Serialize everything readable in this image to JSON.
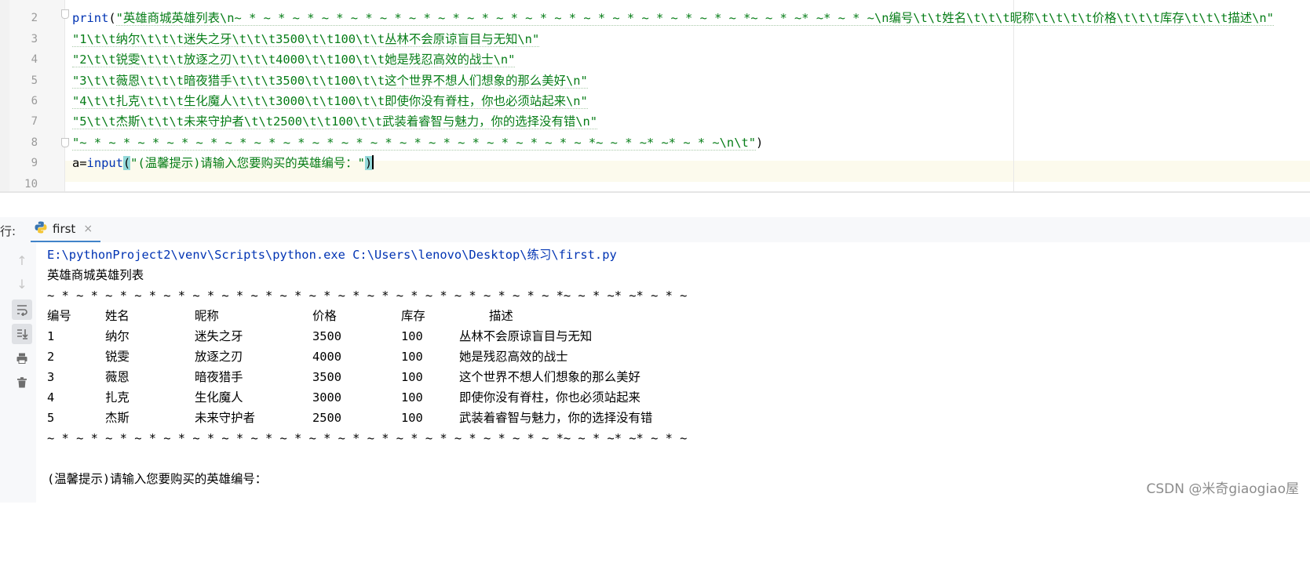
{
  "editor": {
    "line_numbers": [
      "2",
      "3",
      "4",
      "5",
      "6",
      "7",
      "8",
      "9",
      "10"
    ],
    "lines": {
      "l2_kw": "print",
      "l2_paren": "(",
      "l2_str": "\"英雄商城英雄列表\\n~ * ~ * ~ * ~ * ~ * ~ * ~ * ~ * ~ * ~ * ~ * ~ * ~ * ~ * ~ * ~ * ~ * ~ *~ ~ * ~* ~* ~ * ~\\n编号\\t\\t姓名\\t\\t\\t昵称\\t\\t\\t\\t价格\\t\\t\\t库存\\t\\t\\t描述\\n\"",
      "l3": "\"1\\t\\t纳尔\\t\\t\\t迷失之牙\\t\\t\\t3500\\t\\t100\\t\\t丛林不会原谅盲目与无知\\n\"",
      "l4": "\"2\\t\\t锐雯\\t\\t\\t放逐之刃\\t\\t\\t4000\\t\\t100\\t\\t她是残忍高效的战士\\n\"",
      "l5": "\"3\\t\\t薇恩\\t\\t\\t暗夜猎手\\t\\t\\t3500\\t\\t100\\t\\t这个世界不想人们想象的那么美好\\n\"",
      "l6": "\"4\\t\\t扎克\\t\\t\\t生化魔人\\t\\t\\t3000\\t\\t100\\t\\t即使你没有脊柱，你也必须站起来\\n\"",
      "l7": "\"5\\t\\t杰斯\\t\\t\\t未来守护者\\t\\t2500\\t\\t100\\t\\t武装着睿智与魅力，你的选择没有错\\n\"",
      "l8_str": "\"~ * ~ * ~ * ~ * ~ * ~ * ~ * ~ * ~ * ~ * ~ * ~ * ~ * ~ * ~ * ~ * ~ * ~ *~ ~ * ~* ~* ~ * ~\\n\\t\"",
      "l8_close": ")",
      "l9_var": "a=",
      "l9_kw": "input",
      "l9_open": "(",
      "l9_str": "\"(温馨提示)请输入您要购买的英雄编号：\"",
      "l9_close": ")"
    }
  },
  "run_panel": {
    "label": "行:",
    "tab_name": "first",
    "tab_close": "×"
  },
  "console": {
    "command": "E:\\pythonProject2\\venv\\Scripts\\python.exe C:\\Users\\lenovo\\Desktop\\练习\\first.py",
    "title": "英雄商城英雄列表",
    "separator": "~ * ~ * ~ * ~ * ~ * ~ * ~ * ~ * ~ * ~ * ~ * ~ * ~ * ~ * ~ * ~ * ~ * ~ *~ ~ * ~* ~* ~ * ~",
    "headers": [
      "编号",
      "姓名",
      "昵称",
      "价格",
      "库存",
      "描述"
    ],
    "rows": [
      [
        "1",
        "纳尔",
        "迷失之牙",
        "3500",
        "100",
        "丛林不会原谅盲目与无知"
      ],
      [
        "2",
        "锐雯",
        "放逐之刃",
        "4000",
        "100",
        "她是残忍高效的战士"
      ],
      [
        "3",
        "薇恩",
        "暗夜猎手",
        "3500",
        "100",
        "这个世界不想人们想象的那么美好"
      ],
      [
        "4",
        "扎克",
        "生化魔人",
        "3000",
        "100",
        "即使你没有脊柱，你也必须站起来"
      ],
      [
        "5",
        "杰斯",
        "未来守护者",
        "2500",
        "100",
        "武装着睿智与魅力，你的选择没有错"
      ]
    ],
    "prompt": "(温馨提示)请输入您要购买的英雄编号："
  },
  "toolbar_icons": [
    "arrow-up-icon",
    "arrow-down-icon",
    "soft-wrap-icon",
    "scroll-to-end-icon",
    "print-icon",
    "trash-icon"
  ],
  "watermark": "CSDN @米奇giaogiao屋",
  "colors": {
    "string": "#067d17",
    "keyword": "#0033b3",
    "tab_underline": "#4083c9",
    "current_line": "#fcfaed"
  }
}
